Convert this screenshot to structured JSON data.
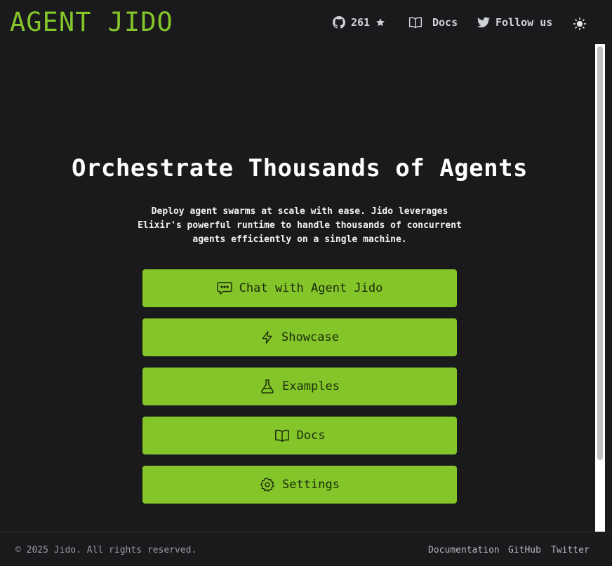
{
  "brand": {
    "logo": "AGENT JIDO",
    "accent": "#84c52a"
  },
  "nav": {
    "github_stars": "261",
    "docs_label": "Docs",
    "follow_label": "Follow us",
    "icons": [
      "github-icon",
      "star-icon",
      "book-icon",
      "twitter-icon",
      "sun-icon"
    ]
  },
  "hero": {
    "title": "Orchestrate Thousands of Agents",
    "subtitle": "Deploy agent swarms at scale with ease. Jido leverages Elixir's powerful runtime to handle thousands of concurrent agents efficiently on a single machine."
  },
  "actions": [
    {
      "label": "Chat with Agent Jido",
      "icon": "chat-icon"
    },
    {
      "label": "Showcase",
      "icon": "bolt-icon"
    },
    {
      "label": "Examples",
      "icon": "flask-icon"
    },
    {
      "label": "Docs",
      "icon": "book-icon"
    },
    {
      "label": "Settings",
      "icon": "settings-icon"
    }
  ],
  "footer": {
    "copyright": "© 2025 Jido. All rights reserved.",
    "links": [
      "Documentation",
      "GitHub",
      "Twitter"
    ]
  }
}
